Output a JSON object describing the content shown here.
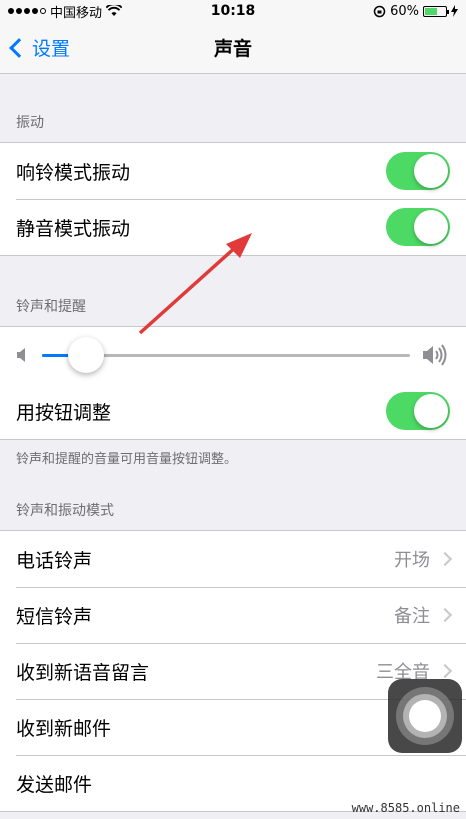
{
  "status_bar": {
    "carrier": "中国移动",
    "time": "10:18",
    "battery": "60%",
    "battery_level": 0.6
  },
  "nav": {
    "back_label": "设置",
    "title": "声音"
  },
  "vibration": {
    "header": "振动",
    "rows": [
      {
        "label": "响铃模式振动",
        "on": true
      },
      {
        "label": "静音模式振动",
        "on": true
      }
    ]
  },
  "ringer": {
    "header": "铃声和提醒",
    "volume_level": 0.12,
    "button_adjust": {
      "label": "用按钮调整",
      "on": true
    },
    "footnote": "铃声和提醒的音量可用音量按钮调整。"
  },
  "sounds": {
    "header": "铃声和振动模式",
    "rows": [
      {
        "label": "电话铃声",
        "value": "开场"
      },
      {
        "label": "短信铃声",
        "value": "备注"
      },
      {
        "label": "收到新语音留言",
        "value": "三全音"
      },
      {
        "label": "收到新邮件",
        "value": ""
      },
      {
        "label": "发送邮件",
        "value": ""
      }
    ]
  },
  "colors": {
    "accent": "#007aff",
    "toggle_on": "#4cd964",
    "annotation_arrow": "#e03a3a"
  },
  "watermark": "www.8585.online"
}
